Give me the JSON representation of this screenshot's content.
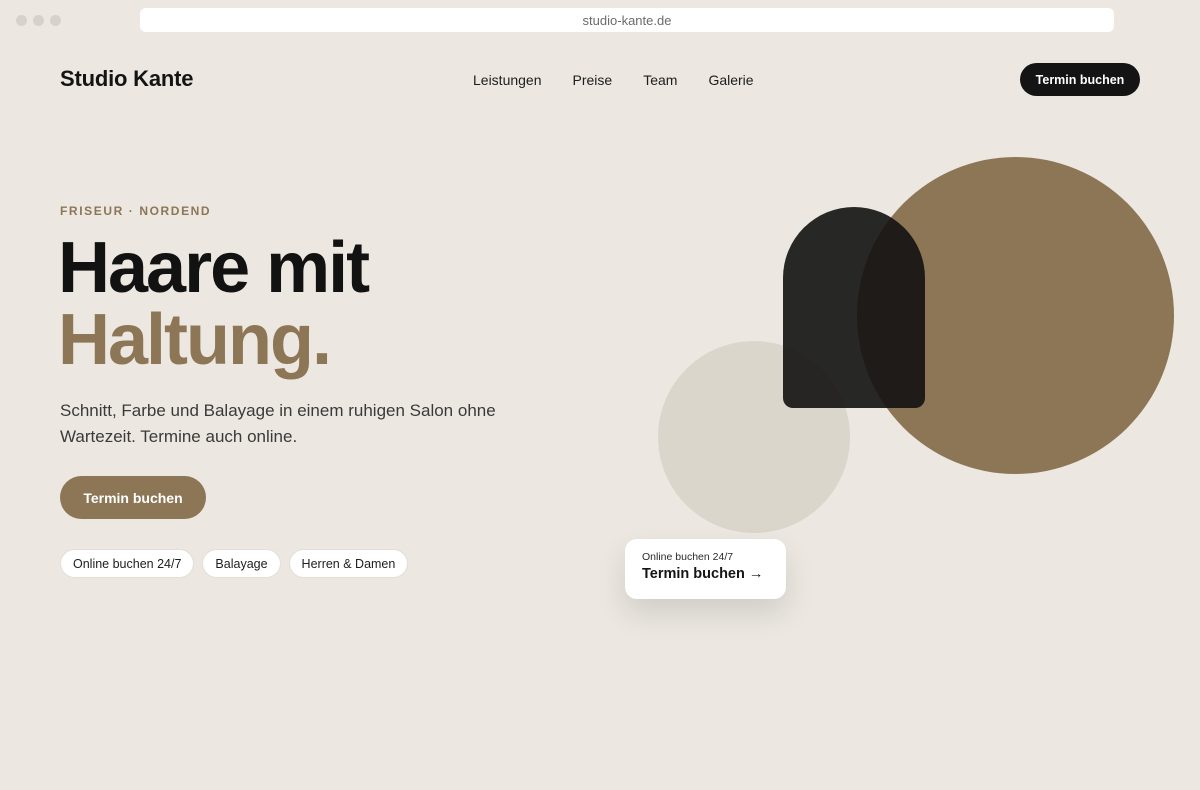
{
  "browser": {
    "url": "studio-kante.de"
  },
  "header": {
    "logo": "Studio Kante",
    "nav": [
      "Leistungen",
      "Preise",
      "Team",
      "Galerie"
    ],
    "cta": "Termin buchen"
  },
  "hero": {
    "eyebrow": "FRISEUR · NORDEND",
    "headline_line1": "Haare mit",
    "headline_line2": "Haltung.",
    "lead": "Schnitt, Farbe und Balayage in einem ruhigen Salon ohne Wartezeit. Termine auch online.",
    "cta": "Termin buchen",
    "chips": [
      "Online buchen 24/7",
      "Balayage",
      "Herren & Damen"
    ]
  },
  "booking_card": {
    "label": "Online buchen 24/7",
    "action": "Termin buchen",
    "arrow": "→"
  },
  "colors": {
    "background": "#ece8e1",
    "accent": "#8c7656",
    "dark": "#141414",
    "light_circle": "#dbd6cc"
  }
}
